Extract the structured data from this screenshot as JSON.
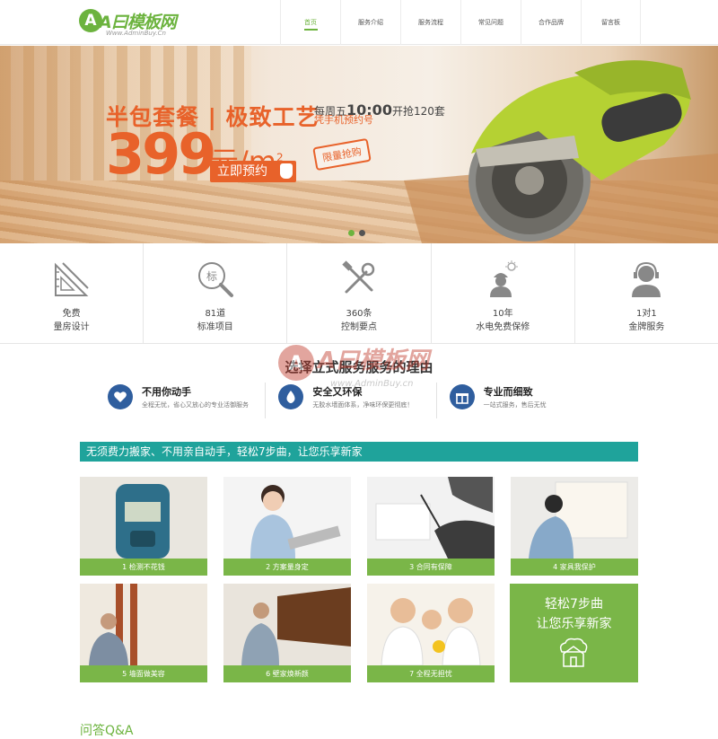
{
  "header": {
    "logo_mark": "A",
    "logo_text": "A曰模板网",
    "logo_sub": "Www.AdminBuy.Cn",
    "nav": [
      {
        "label": "首页",
        "active": true
      },
      {
        "label": "服务介绍",
        "active": false
      },
      {
        "label": "服务流程",
        "active": false
      },
      {
        "label": "常见问题",
        "active": false
      },
      {
        "label": "合作品牌",
        "active": false
      },
      {
        "label": "留言板",
        "active": false
      }
    ]
  },
  "banner": {
    "title": "半包套餐 | 极致工艺",
    "price": "399",
    "unit": "元/m",
    "unit_sup": "2",
    "cta": "立即预约",
    "weekday_text": "每周五",
    "time_text": "10:00",
    "offer_text": "开抢120套",
    "line2": "凭手机预约号",
    "badge": "限量抢购",
    "dots": [
      {
        "active": true
      },
      {
        "active": false
      }
    ]
  },
  "services": [
    {
      "icon": "ruler-triangle-icon",
      "line1": "免费",
      "line2": "量房设计"
    },
    {
      "icon": "magnifier-standard-icon",
      "line1": "81道",
      "line2": "标准项目",
      "icon_text": "标"
    },
    {
      "icon": "tools-icon",
      "line1": "360条",
      "line2": "控制要点"
    },
    {
      "icon": "worker-icon",
      "line1": "10年",
      "line2": "水电免费保修"
    },
    {
      "icon": "support-agent-icon",
      "line1": "1对1",
      "line2": "金牌服务"
    }
  ],
  "reasons": {
    "title": "选择立式服务服务的理由",
    "watermark_text": "A曰模板网",
    "watermark_sub": "www.AdminBuy.cn",
    "items": [
      {
        "icon": "heart-icon",
        "title": "不用你动手",
        "desc": "全程无忧，省心又放心的专业活御服务"
      },
      {
        "icon": "leaf-drop-icon",
        "title": "安全又环保",
        "desc": "无胶水墙面体系，净味环保更彻底！"
      },
      {
        "icon": "gift-icon",
        "title": "专业而细致",
        "desc": "一站式服务，售后无忧"
      }
    ]
  },
  "steps": {
    "bar_text": "无须费力搬家、不用亲自动手，轻松7步曲，让您乐享新家",
    "items": [
      {
        "caption": "1 检测不花钱",
        "scene": "meter"
      },
      {
        "caption": "2 方案量身定",
        "scene": "consultant"
      },
      {
        "caption": "3 合同有保障",
        "scene": "contract"
      },
      {
        "caption": "4 家具我保护",
        "scene": "wrap"
      },
      {
        "caption": "5 墙面做美容",
        "scene": "wall"
      },
      {
        "caption": "6 壁家焕新颜",
        "scene": "paper"
      },
      {
        "caption": "7 全程无担忧",
        "scene": "family"
      }
    ],
    "promo_l1": "轻松7步曲",
    "promo_l2": "让您乐享新家"
  },
  "qa": {
    "title": "问答Q&A"
  },
  "colors": {
    "accent": "#6cb33e",
    "orange": "#e8622a",
    "teal": "#1fa39b",
    "step_green": "#7ab648",
    "reason_blue": "#2f5e9e"
  }
}
